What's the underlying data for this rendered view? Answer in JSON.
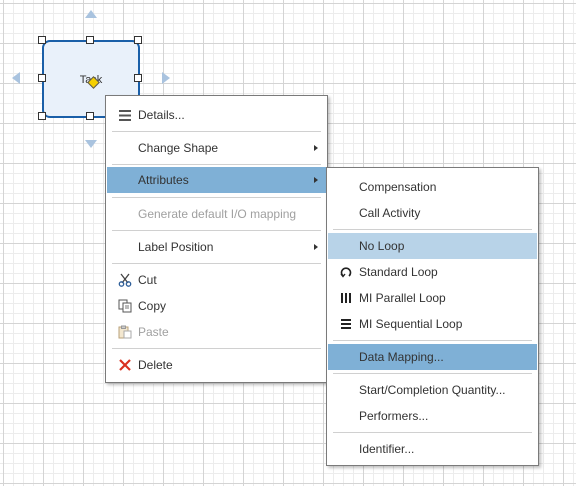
{
  "canvas": {
    "task_label": "Task"
  },
  "main_menu": {
    "items": [
      {
        "label": "Details...",
        "icon": "list-icon"
      },
      {
        "label": "Change Shape"
      },
      {
        "label": "Attributes"
      },
      {
        "label": "Generate default I/O mapping"
      },
      {
        "label": "Label Position"
      },
      {
        "label": "Cut",
        "icon": "scissors-icon"
      },
      {
        "label": "Copy",
        "icon": "copy-icon"
      },
      {
        "label": "Paste",
        "icon": "paste-icon"
      },
      {
        "label": "Delete",
        "icon": "delete-x-icon"
      }
    ]
  },
  "sub_menu": {
    "items": [
      {
        "label": "Compensation"
      },
      {
        "label": "Call Activity"
      },
      {
        "label": "No Loop"
      },
      {
        "label": "Standard Loop",
        "icon": "standard-loop-icon"
      },
      {
        "label": "MI Parallel Loop",
        "icon": "parallel-bars-icon"
      },
      {
        "label": "MI Sequential Loop",
        "icon": "sequential-bars-icon"
      },
      {
        "label": "Data Mapping..."
      },
      {
        "label": "Start/Completion Quantity..."
      },
      {
        "label": "Performers..."
      },
      {
        "label": "Identifier..."
      }
    ]
  },
  "colors": {
    "active": "#7fb0d6",
    "hover": "#b8d3e8",
    "task_border": "#1a5fa8",
    "delete": "#d9301f"
  }
}
